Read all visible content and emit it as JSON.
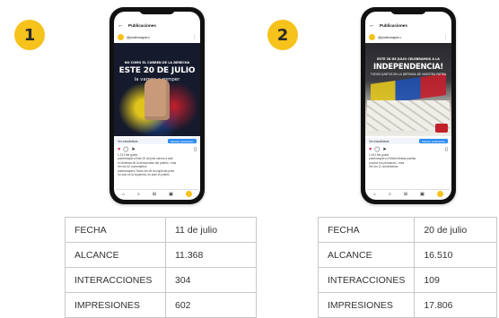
{
  "posts": [
    {
      "number": "1",
      "screen_title": "Publicaciones",
      "account": "@podemosperu",
      "image": {
        "kicker": "NO COMO EL CUBREN DE LA DERECHA",
        "headline": "ESTE 20 DE JULIO",
        "subhead": "la vamos a romper"
      },
      "cta_text": "Ver estadísticas",
      "cta_button": "Mostrar publicación",
      "likes": "1.213 Me gusta",
      "caption_lines": [
        "podemosperu Este 20 de julio vamos a salir",
        "en defensa de la democracia del pueblo...más",
        "Ver los 42 comentarios",
        "podemosperu Todos los de la izquierda pues",
        "no solo es la izquierda, es todo el pueblo"
      ],
      "stats": [
        {
          "label": "FECHA",
          "value": "11 de julio"
        },
        {
          "label": "ALCANCE",
          "value": "11.368"
        },
        {
          "label": "INTERACCIONES",
          "value": "304"
        },
        {
          "label": "IMPRESIONES",
          "value": "602"
        }
      ]
    },
    {
      "number": "2",
      "screen_title": "Publicaciones",
      "account": "@podemosperu",
      "image": {
        "kicker": "ESTE 28 DE JULIO CELEBRAMOS A LA",
        "headline": "INDEPENDENCIA!",
        "subhead": "TODOS JUNTOS EN LA DEFENSA DE NUESTRA PATRIA"
      },
      "cta_text": "Ver estadísticas",
      "cta_button": "Mostrar publicación",
      "likes": "1.041 Me gusta",
      "caption_lines": [
        "podemosperu ¡Felices fiestas patrias",
        "a todos los peruanos!...más",
        "Ver los 11 comentarios"
      ],
      "stats": [
        {
          "label": "FECHA",
          "value": "20 de julio"
        },
        {
          "label": "ALCANCE",
          "value": "16.510"
        },
        {
          "label": "INTERACCIONES",
          "value": "109"
        },
        {
          "label": "IMPRESIONES",
          "value": "17.806"
        }
      ]
    }
  ],
  "icons": {
    "back": "arrow-left-icon",
    "heart": "heart-icon",
    "comment": "comment-icon",
    "share": "send-icon",
    "save": "bookmark-icon"
  },
  "colors": {
    "badge": "#f6c21c",
    "accent": "#2d8cf0",
    "border": "#c8c8c8"
  }
}
